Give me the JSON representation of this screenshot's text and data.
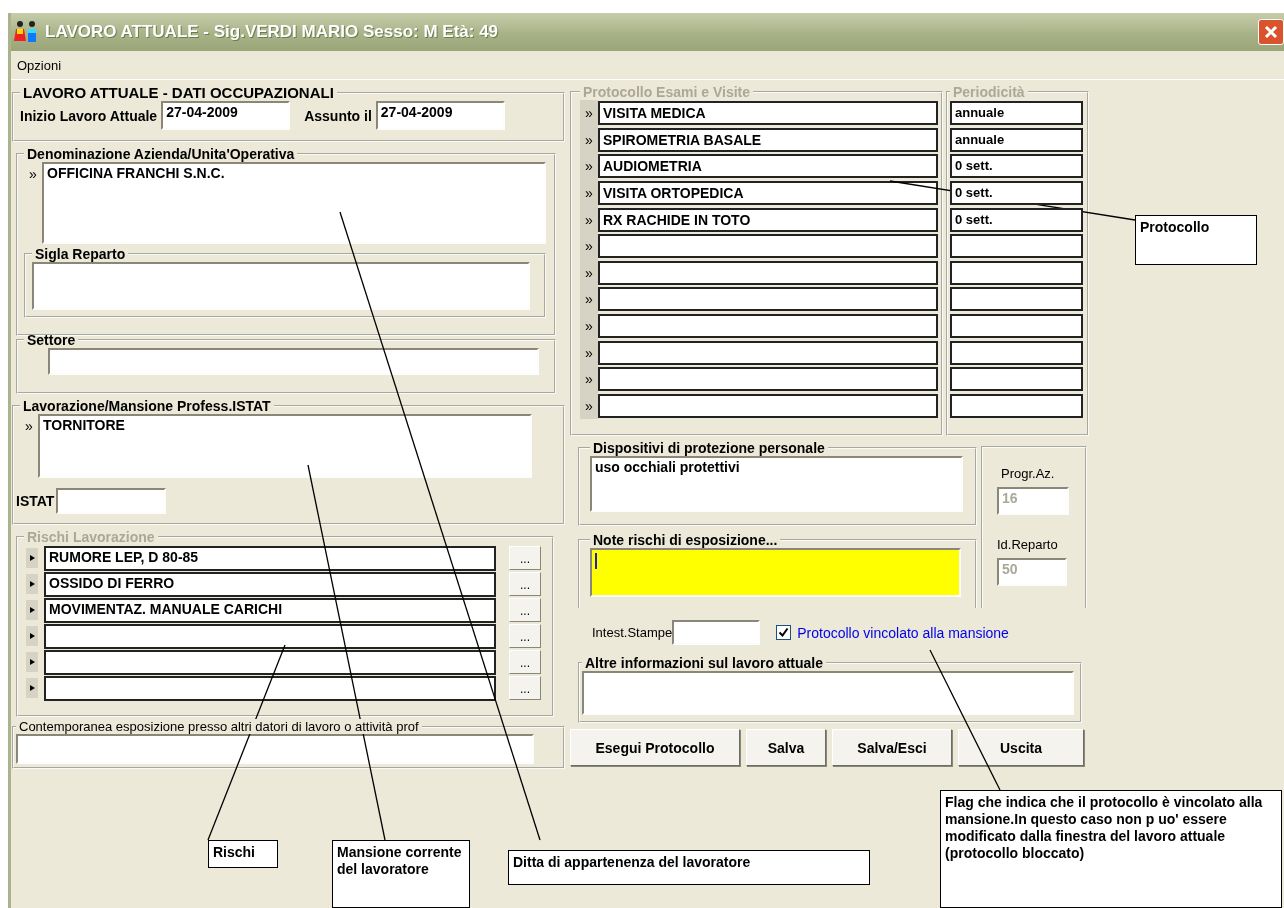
{
  "window": {
    "title": "LAVORO ATTUALE - Sig.VERDI MARIO Sesso: M Età: 49"
  },
  "menu": [
    "Opzioni"
  ],
  "occupational": {
    "title": "LAVORO ATTUALE - DATI OCCUPAZIONALI",
    "start_label": "Inizio Lavoro Attuale",
    "start_value": "27-04-2009",
    "hired_label": "Assunto il",
    "hired_value": "27-04-2009"
  },
  "company": {
    "title": "Denominazione Azienda/Unita'Operativa",
    "marker": "»",
    "value": "OFFICINA FRANCHI S.N.C.",
    "department_title": "Sigla Reparto"
  },
  "sector": {
    "title": "Settore"
  },
  "job": {
    "title": "Lavorazione/Mansione Profess.ISTAT",
    "marker": "»",
    "value": "TORNITORE",
    "istat_label": "ISTAT"
  },
  "risks": {
    "title": "Rischi Lavorazione",
    "disabled": true,
    "rows": [
      {
        "value": "RUMORE LEP, D  80-85",
        "button": "..."
      },
      {
        "value": "OSSIDO DI FERRO",
        "button": "..."
      },
      {
        "value": "MOVIMENTAZ. MANUALE CARICHI",
        "button": "..."
      },
      {
        "button": "..."
      },
      {
        "button": "..."
      },
      {
        "button": "..."
      }
    ]
  },
  "concurrent": {
    "title": "Contemporanea esposizione presso altri datori di lavoro o attività prof"
  },
  "protocol": {
    "title": "Protocollo Esami e Visite",
    "period_title": "Periodicità",
    "disabled": true,
    "rows": [
      {
        "marker": "»",
        "exam": "VISITA MEDICA",
        "period": "annuale"
      },
      {
        "marker": "»",
        "exam": "SPIROMETRIA BASALE",
        "period": "annuale"
      },
      {
        "marker": "»",
        "exam": "AUDIOMETRIA",
        "period": "0 sett."
      },
      {
        "marker": "»",
        "exam": "VISITA ORTOPEDICA",
        "period": "0 sett."
      },
      {
        "marker": "»",
        "exam": "RX RACHIDE IN TOTO",
        "period": "0 sett."
      },
      {
        "marker": "»"
      },
      {
        "marker": "»"
      },
      {
        "marker": "»"
      },
      {
        "marker": "»"
      },
      {
        "marker": "»"
      },
      {
        "marker": "»"
      },
      {
        "marker": "»"
      }
    ]
  },
  "ppe": {
    "title": "Dispositivi di protezione personale",
    "value": "uso occhiali protettivi"
  },
  "ids": {
    "disabled": true,
    "progr_label": "Progr.Az.",
    "progr_value": "16",
    "reparto_label": "Id.Reparto",
    "reparto_value": "50"
  },
  "risk_notes": {
    "title": "Note rischi di esposizione...",
    "focused": true
  },
  "print_header": {
    "label": "Intest.Stampe"
  },
  "protocol_bound": {
    "label": "Protocollo vincolato alla mansione",
    "checked": true
  },
  "other_info": {
    "title": "Altre informazioni sul lavoro attuale"
  },
  "buttons": [
    "Esegui Protocollo",
    "Salva",
    "Salva/Esci",
    "Uscita"
  ],
  "annotations": [
    {
      "text": "Protocollo"
    },
    {
      "text": "Rischi"
    },
    {
      "text": "Mansione corrente del lavoratore"
    },
    {
      "text": "Ditta di appartenenza del lavoratore"
    },
    {
      "text": "Flag che indica che il protocollo è vincolato alla mansione.In questo caso non p uo' essere modificato dalla finestra del lavoro attuale (protocollo bloccato)"
    }
  ]
}
